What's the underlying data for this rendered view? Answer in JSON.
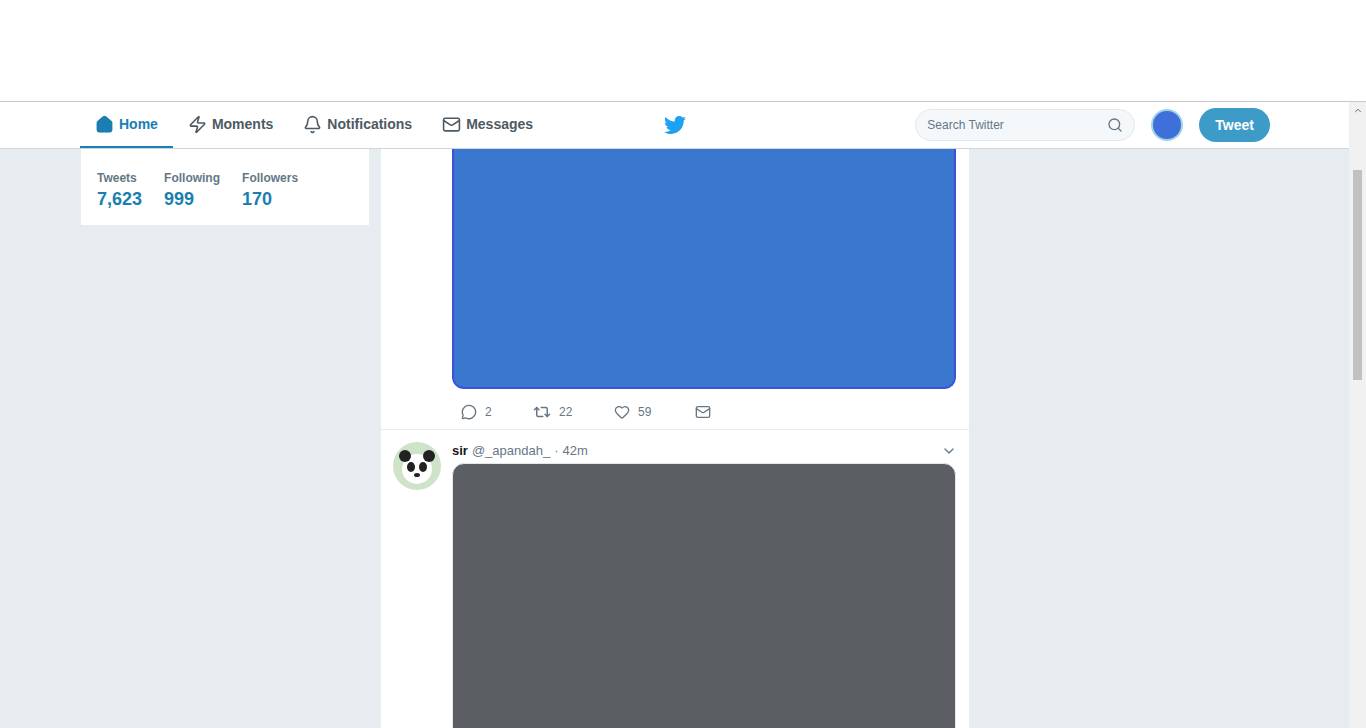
{
  "nav": {
    "tabs": [
      {
        "label": "Home",
        "selected": true,
        "icon": "home"
      },
      {
        "label": "Moments",
        "selected": false,
        "icon": "moments"
      },
      {
        "label": "Notifications",
        "selected": false,
        "icon": "notifications"
      },
      {
        "label": "Messages",
        "selected": false,
        "icon": "messages"
      }
    ],
    "search": {
      "placeholder": "Search Twitter"
    },
    "tweet_button": "Tweet"
  },
  "profile_stats": [
    {
      "label": "Tweets",
      "value": "7,623"
    },
    {
      "label": "Following",
      "value": "999"
    },
    {
      "label": "Followers",
      "value": "170"
    }
  ],
  "tweets": [
    {
      "kind": "media-actions",
      "focused": true,
      "replies": "2",
      "retweets": "22",
      "likes": "59"
    },
    {
      "kind": "header-media",
      "focused": false,
      "name": "sir",
      "handle": "@_apandah_",
      "separator": "·",
      "time": "42m"
    }
  ]
}
